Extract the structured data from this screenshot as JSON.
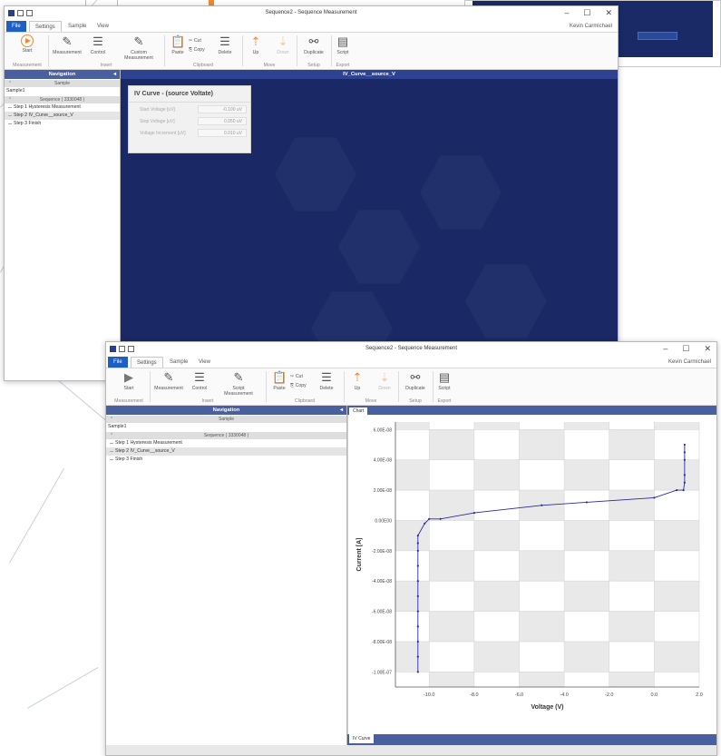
{
  "app": {
    "title": "Sequence2 - Sequence Measurement",
    "user": "Kevin Carmichael",
    "menu": {
      "file": "File",
      "settings": "Settings",
      "sample": "Sample",
      "view": "View"
    },
    "window_controls": {
      "minimize": "–",
      "maximize": "☐",
      "close": "✕"
    }
  },
  "ribbon": {
    "start": "Start",
    "measurement": "Measurement",
    "control": "Control",
    "custom_measurement": "Custom Measurement",
    "script_measurement": "Script Measurement",
    "paste": "Paste",
    "cut": "Cut",
    "copy": "Copy",
    "delete": "Delete",
    "up": "Up",
    "down": "Down",
    "duplicate": "Duplicate",
    "script": "Script",
    "groups": {
      "measurement": "Measurement",
      "insert": "Insert",
      "clipboard": "Clipboard",
      "move": "Move",
      "setup": "Setup",
      "export": "Export"
    }
  },
  "navigation": {
    "header": "Navigation",
    "collapse_glyph": "◂",
    "sample_section": "Sample",
    "sample_item": "Sample1",
    "sequence_section": "Sequence ( 3330048 )",
    "steps": [
      "Step 1 Hysteresis Measurement",
      "Step 2 IV_Curve__source_V",
      "Step 3 Finish"
    ]
  },
  "win1": {
    "main_header": "IV_Curve__source_V",
    "panel_title": "IV Curve - (source Voltate)",
    "fields": [
      {
        "label": "Start Voltage [uV]",
        "value": "-0.100 uV"
      },
      {
        "label": "Stop Voltage [uV]",
        "value": "0.050 uV"
      },
      {
        "label": "Voltage Increment [uV]",
        "value": "0.010 uV"
      }
    ]
  },
  "win2": {
    "chart_tab": "Chart",
    "bottom_tab": "IV Curve"
  },
  "chart_data": {
    "type": "line",
    "title": "",
    "xlabel": "Voltage (V)",
    "ylabel": "Current [A]",
    "xlim": [
      -11.5,
      2.0
    ],
    "ylim": [
      -1.1e-07,
      6.5e-08
    ],
    "xticks": [
      -10.0,
      -8.0,
      -6.0,
      -4.0,
      -2.0,
      0.0,
      2.0
    ],
    "xtick_labels": [
      "-10.0",
      "-8.0",
      "-6.0",
      "-4.0",
      "-2.0",
      "0.0",
      "2.0"
    ],
    "yticks": [
      6e-08,
      4e-08,
      2e-08,
      0,
      -2e-08,
      -4e-08,
      -6e-08,
      -8e-08,
      -1e-07
    ],
    "ytick_labels": [
      "6.00E-08",
      "4.00E-08",
      "2.00E-08",
      "0.00E00",
      "-2.00E-08",
      "-4.00E-08",
      "-6.00E-08",
      "-8.00E-08",
      "-1.00E-07"
    ],
    "grid": true,
    "colors": {
      "line": "#2a2aa0",
      "band": "#e9e9e9"
    },
    "series": [
      {
        "x": [
          -10.5,
          -10.5,
          -10.5,
          -10.5,
          -10.5,
          -10.5,
          -10.5,
          -10.5,
          -10.5,
          -10.5,
          -10.5,
          -10.2,
          -10.0,
          -9.5,
          -8.0,
          -5.0,
          -3.0,
          0.0,
          1.0,
          1.3,
          1.35,
          1.35,
          1.35,
          1.35,
          1.35
        ],
        "y": [
          -1e-07,
          -9e-08,
          -8e-08,
          -7e-08,
          -6e-08,
          -5e-08,
          -4e-08,
          -3e-08,
          -2e-08,
          -1.5e-08,
          -1e-08,
          -2e-09,
          1e-09,
          1e-09,
          5e-09,
          1e-08,
          1.2e-08,
          1.5e-08,
          2e-08,
          2e-08,
          2.5e-08,
          3e-08,
          4e-08,
          4.5e-08,
          5e-08
        ]
      }
    ]
  }
}
